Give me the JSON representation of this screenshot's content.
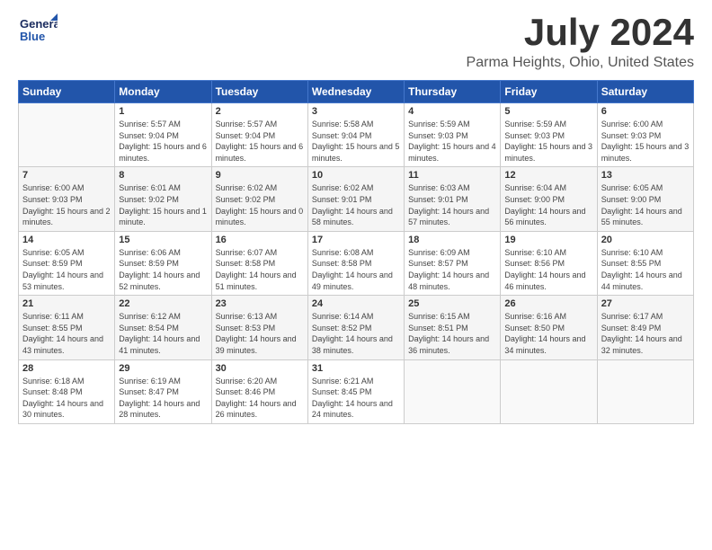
{
  "header": {
    "logo_general": "General",
    "logo_blue": "Blue",
    "month_title": "July 2024",
    "location": "Parma Heights, Ohio, United States"
  },
  "weekdays": [
    "Sunday",
    "Monday",
    "Tuesday",
    "Wednesday",
    "Thursday",
    "Friday",
    "Saturday"
  ],
  "weeks": [
    [
      {
        "day": "",
        "sunrise": "",
        "sunset": "",
        "daylight": ""
      },
      {
        "day": "1",
        "sunrise": "Sunrise: 5:57 AM",
        "sunset": "Sunset: 9:04 PM",
        "daylight": "Daylight: 15 hours and 6 minutes."
      },
      {
        "day": "2",
        "sunrise": "Sunrise: 5:57 AM",
        "sunset": "Sunset: 9:04 PM",
        "daylight": "Daylight: 15 hours and 6 minutes."
      },
      {
        "day": "3",
        "sunrise": "Sunrise: 5:58 AM",
        "sunset": "Sunset: 9:04 PM",
        "daylight": "Daylight: 15 hours and 5 minutes."
      },
      {
        "day": "4",
        "sunrise": "Sunrise: 5:59 AM",
        "sunset": "Sunset: 9:03 PM",
        "daylight": "Daylight: 15 hours and 4 minutes."
      },
      {
        "day": "5",
        "sunrise": "Sunrise: 5:59 AM",
        "sunset": "Sunset: 9:03 PM",
        "daylight": "Daylight: 15 hours and 3 minutes."
      },
      {
        "day": "6",
        "sunrise": "Sunrise: 6:00 AM",
        "sunset": "Sunset: 9:03 PM",
        "daylight": "Daylight: 15 hours and 3 minutes."
      }
    ],
    [
      {
        "day": "7",
        "sunrise": "Sunrise: 6:00 AM",
        "sunset": "Sunset: 9:03 PM",
        "daylight": "Daylight: 15 hours and 2 minutes."
      },
      {
        "day": "8",
        "sunrise": "Sunrise: 6:01 AM",
        "sunset": "Sunset: 9:02 PM",
        "daylight": "Daylight: 15 hours and 1 minute."
      },
      {
        "day": "9",
        "sunrise": "Sunrise: 6:02 AM",
        "sunset": "Sunset: 9:02 PM",
        "daylight": "Daylight: 15 hours and 0 minutes."
      },
      {
        "day": "10",
        "sunrise": "Sunrise: 6:02 AM",
        "sunset": "Sunset: 9:01 PM",
        "daylight": "Daylight: 14 hours and 58 minutes."
      },
      {
        "day": "11",
        "sunrise": "Sunrise: 6:03 AM",
        "sunset": "Sunset: 9:01 PM",
        "daylight": "Daylight: 14 hours and 57 minutes."
      },
      {
        "day": "12",
        "sunrise": "Sunrise: 6:04 AM",
        "sunset": "Sunset: 9:00 PM",
        "daylight": "Daylight: 14 hours and 56 minutes."
      },
      {
        "day": "13",
        "sunrise": "Sunrise: 6:05 AM",
        "sunset": "Sunset: 9:00 PM",
        "daylight": "Daylight: 14 hours and 55 minutes."
      }
    ],
    [
      {
        "day": "14",
        "sunrise": "Sunrise: 6:05 AM",
        "sunset": "Sunset: 8:59 PM",
        "daylight": "Daylight: 14 hours and 53 minutes."
      },
      {
        "day": "15",
        "sunrise": "Sunrise: 6:06 AM",
        "sunset": "Sunset: 8:59 PM",
        "daylight": "Daylight: 14 hours and 52 minutes."
      },
      {
        "day": "16",
        "sunrise": "Sunrise: 6:07 AM",
        "sunset": "Sunset: 8:58 PM",
        "daylight": "Daylight: 14 hours and 51 minutes."
      },
      {
        "day": "17",
        "sunrise": "Sunrise: 6:08 AM",
        "sunset": "Sunset: 8:58 PM",
        "daylight": "Daylight: 14 hours and 49 minutes."
      },
      {
        "day": "18",
        "sunrise": "Sunrise: 6:09 AM",
        "sunset": "Sunset: 8:57 PM",
        "daylight": "Daylight: 14 hours and 48 minutes."
      },
      {
        "day": "19",
        "sunrise": "Sunrise: 6:10 AM",
        "sunset": "Sunset: 8:56 PM",
        "daylight": "Daylight: 14 hours and 46 minutes."
      },
      {
        "day": "20",
        "sunrise": "Sunrise: 6:10 AM",
        "sunset": "Sunset: 8:55 PM",
        "daylight": "Daylight: 14 hours and 44 minutes."
      }
    ],
    [
      {
        "day": "21",
        "sunrise": "Sunrise: 6:11 AM",
        "sunset": "Sunset: 8:55 PM",
        "daylight": "Daylight: 14 hours and 43 minutes."
      },
      {
        "day": "22",
        "sunrise": "Sunrise: 6:12 AM",
        "sunset": "Sunset: 8:54 PM",
        "daylight": "Daylight: 14 hours and 41 minutes."
      },
      {
        "day": "23",
        "sunrise": "Sunrise: 6:13 AM",
        "sunset": "Sunset: 8:53 PM",
        "daylight": "Daylight: 14 hours and 39 minutes."
      },
      {
        "day": "24",
        "sunrise": "Sunrise: 6:14 AM",
        "sunset": "Sunset: 8:52 PM",
        "daylight": "Daylight: 14 hours and 38 minutes."
      },
      {
        "day": "25",
        "sunrise": "Sunrise: 6:15 AM",
        "sunset": "Sunset: 8:51 PM",
        "daylight": "Daylight: 14 hours and 36 minutes."
      },
      {
        "day": "26",
        "sunrise": "Sunrise: 6:16 AM",
        "sunset": "Sunset: 8:50 PM",
        "daylight": "Daylight: 14 hours and 34 minutes."
      },
      {
        "day": "27",
        "sunrise": "Sunrise: 6:17 AM",
        "sunset": "Sunset: 8:49 PM",
        "daylight": "Daylight: 14 hours and 32 minutes."
      }
    ],
    [
      {
        "day": "28",
        "sunrise": "Sunrise: 6:18 AM",
        "sunset": "Sunset: 8:48 PM",
        "daylight": "Daylight: 14 hours and 30 minutes."
      },
      {
        "day": "29",
        "sunrise": "Sunrise: 6:19 AM",
        "sunset": "Sunset: 8:47 PM",
        "daylight": "Daylight: 14 hours and 28 minutes."
      },
      {
        "day": "30",
        "sunrise": "Sunrise: 6:20 AM",
        "sunset": "Sunset: 8:46 PM",
        "daylight": "Daylight: 14 hours and 26 minutes."
      },
      {
        "day": "31",
        "sunrise": "Sunrise: 6:21 AM",
        "sunset": "Sunset: 8:45 PM",
        "daylight": "Daylight: 14 hours and 24 minutes."
      },
      {
        "day": "",
        "sunrise": "",
        "sunset": "",
        "daylight": ""
      },
      {
        "day": "",
        "sunrise": "",
        "sunset": "",
        "daylight": ""
      },
      {
        "day": "",
        "sunrise": "",
        "sunset": "",
        "daylight": ""
      }
    ]
  ]
}
